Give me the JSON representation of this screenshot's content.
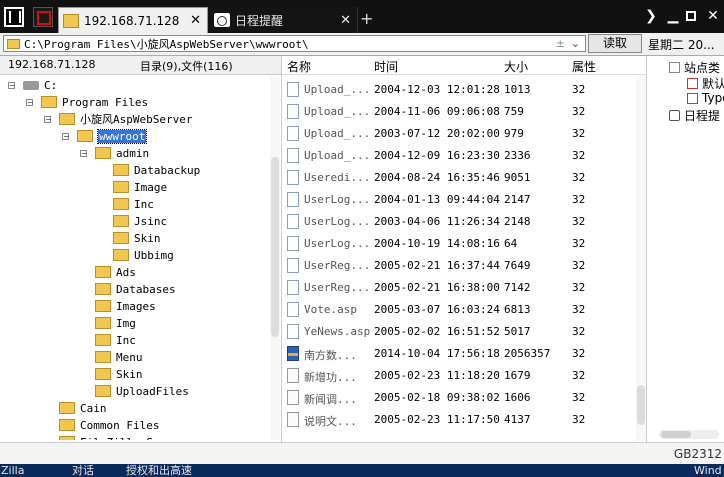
{
  "tabs": [
    {
      "label": "192.168.71.128",
      "icon": "folder-icon",
      "active": true
    },
    {
      "label": "日程提醒",
      "icon": "calendar-icon",
      "active": false
    }
  ],
  "address": {
    "value": "C:\\Program Files\\小旋风AspWebServer\\wwwroot\\",
    "read_label": "读取",
    "weekday": "星期二 20..."
  },
  "left": {
    "host": "192.168.71.128",
    "summary": "目录(9),文件(116)",
    "tree": [
      {
        "label": "C:",
        "level": 0,
        "icon": "drive",
        "expanded": true
      },
      {
        "label": "Program Files",
        "level": 1,
        "expanded": true
      },
      {
        "label": "小旋风AspWebServer",
        "level": 2,
        "expanded": true
      },
      {
        "label": "wwwroot",
        "level": 3,
        "expanded": true,
        "selected": true
      },
      {
        "label": "admin",
        "level": 4,
        "expanded": true
      },
      {
        "label": "Databackup",
        "level": 5
      },
      {
        "label": "Image",
        "level": 5
      },
      {
        "label": "Inc",
        "level": 5
      },
      {
        "label": "Jsinc",
        "level": 5
      },
      {
        "label": "Skin",
        "level": 5
      },
      {
        "label": "Ubbimg",
        "level": 5
      },
      {
        "label": "Ads",
        "level": 4
      },
      {
        "label": "Databases",
        "level": 4
      },
      {
        "label": "Images",
        "level": 4
      },
      {
        "label": "Img",
        "level": 4
      },
      {
        "label": "Inc",
        "level": 4
      },
      {
        "label": "Menu",
        "level": 4
      },
      {
        "label": "Skin",
        "level": 4
      },
      {
        "label": "UploadFiles",
        "level": 4
      },
      {
        "label": "Cain",
        "level": 2
      },
      {
        "label": "Common Files",
        "level": 2
      },
      {
        "label": "FileZilla Server",
        "level": 2
      }
    ]
  },
  "files": {
    "columns": [
      "名称",
      "时间",
      "大小",
      "属性"
    ],
    "rows": [
      {
        "name": "Upload_...",
        "time": "2004-12-03 12:01:28",
        "size": "1013",
        "attr": "32",
        "icon": "file"
      },
      {
        "name": "Upload_...",
        "time": "2004-11-06 09:06:08",
        "size": "759",
        "attr": "32",
        "icon": "file"
      },
      {
        "name": "Upload_...",
        "time": "2003-07-12 20:02:00",
        "size": "979",
        "attr": "32",
        "icon": "file"
      },
      {
        "name": "Upload_...",
        "time": "2004-12-09 16:23:30",
        "size": "2336",
        "attr": "32",
        "icon": "file"
      },
      {
        "name": "Useredi...",
        "time": "2004-08-24 16:35:46",
        "size": "9051",
        "attr": "32",
        "icon": "file"
      },
      {
        "name": "UserLog...",
        "time": "2004-01-13 09:44:04",
        "size": "2147",
        "attr": "32",
        "icon": "file"
      },
      {
        "name": "UserLog...",
        "time": "2003-04-06 11:26:34",
        "size": "2148",
        "attr": "32",
        "icon": "file"
      },
      {
        "name": "UserLog...",
        "time": "2004-10-19 14:08:16",
        "size": "64",
        "attr": "32",
        "icon": "file"
      },
      {
        "name": "UserReg...",
        "time": "2005-02-21 16:37:44",
        "size": "7649",
        "attr": "32",
        "icon": "file"
      },
      {
        "name": "UserReg...",
        "time": "2005-02-21 16:38:00",
        "size": "7142",
        "attr": "32",
        "icon": "file"
      },
      {
        "name": "Vote.asp",
        "time": "2005-03-07 16:03:24",
        "size": "6813",
        "attr": "32",
        "icon": "file"
      },
      {
        "name": "YeNews.asp",
        "time": "2005-02-02 16:51:52",
        "size": "5017",
        "attr": "32",
        "icon": "file"
      },
      {
        "name": "南方数...",
        "time": "2014-10-04 17:56:18",
        "size": "2056357",
        "attr": "32",
        "icon": "rar"
      },
      {
        "name": "新增功...",
        "time": "2005-02-23 11:18:20",
        "size": "1679",
        "attr": "32",
        "icon": "txt"
      },
      {
        "name": "新闻调...",
        "time": "2005-02-18 09:38:02",
        "size": "1606",
        "attr": "32",
        "icon": "txt"
      },
      {
        "name": "说明文...",
        "time": "2005-02-23 11:17:50",
        "size": "4137",
        "attr": "32",
        "icon": "txt"
      }
    ]
  },
  "right": {
    "items": [
      {
        "label": "站点类",
        "indent": 0,
        "type": "minus"
      },
      {
        "label": "默认",
        "indent": 1,
        "type": "box"
      },
      {
        "label": "Type",
        "indent": 1,
        "type": "box"
      },
      {
        "label": "日程提",
        "indent": 0,
        "type": "cal"
      }
    ]
  },
  "status": {
    "encoding": "GB2312"
  },
  "taskbar": [
    "Zilla",
    "对话",
    "授权和出高速",
    "Wind"
  ],
  "colors": {
    "selection": "#3874d8",
    "folder": "#f1c651",
    "accent_red": "#cc2222"
  }
}
